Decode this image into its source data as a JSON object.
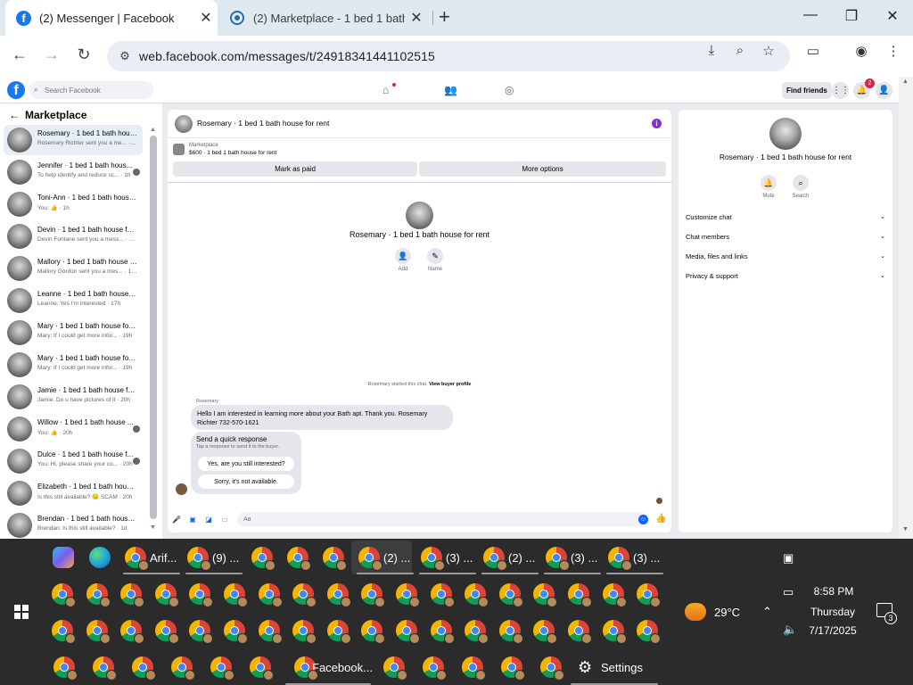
{
  "browser": {
    "tabs": [
      {
        "title": "(2) Messenger | Facebook",
        "active": true
      },
      {
        "title": "(2) Marketplace - 1 bed 1 bath h",
        "active": false
      }
    ],
    "url": "web.facebook.com/messages/t/24918341441102515",
    "window_controls": {
      "minimize": "—",
      "maximize": "❐",
      "close": "✕"
    }
  },
  "fb_header": {
    "search_placeholder": "Search Facebook",
    "find_friends": "Find friends",
    "notif_count": "2"
  },
  "sidebar": {
    "title": "Marketplace",
    "chats": [
      {
        "name": "Rosemary · 1 bed 1 bath house...",
        "preview": "Rosemary Richter sent you a me... · 7m",
        "selected": true,
        "seen_icon": false
      },
      {
        "name": "Jennifer · 1 bed 1 bath hous...",
        "preview": "To help identify and reduce sc... · 1h",
        "selected": false,
        "seen_icon": true
      },
      {
        "name": "Toni-Ann · 1 bed 1 bath house ...",
        "preview": "You: 👍 · 1h",
        "selected": false,
        "seen_icon": false
      },
      {
        "name": "Devin · 1 bed 1 bath house for ...",
        "preview": "Devin Fontane sent you a mess... · 15h",
        "selected": false,
        "seen_icon": false
      },
      {
        "name": "Mallory · 1 bed 1 bath house f...",
        "preview": "Mallory Gordon sent you a mes... · 16h",
        "selected": false,
        "seen_icon": false
      },
      {
        "name": "Leanne · 1 bed 1 bath house fo...",
        "preview": "Leanne: Yes I'm interested · 17h",
        "selected": false,
        "seen_icon": false
      },
      {
        "name": "Mary · 1 bed 1 bath house for ...",
        "preview": "Mary: If I could get more infor... · 19h",
        "selected": false,
        "seen_icon": false
      },
      {
        "name": "Mary · 1 bed 1 bath house for ...",
        "preview": "Mary: If I could get more infor... · 19h",
        "selected": false,
        "seen_icon": false
      },
      {
        "name": "Jamie · 1 bed 1 bath house for ...",
        "preview": "Jamie: Do u have pictures of it · 20h",
        "selected": false,
        "seen_icon": false
      },
      {
        "name": "Willow · 1 bed 1 bath house ...",
        "preview": "You: 👍 · 20h",
        "selected": false,
        "seen_icon": true
      },
      {
        "name": "Dulce · 1 bed 1 bath house f...",
        "preview": "You: Hi, please share your co... · 20h",
        "selected": false,
        "seen_icon": true
      },
      {
        "name": "Elizabeth · 1 bed 1 bath house ...",
        "preview": "Is this still available? 😔 SCAM · 20h",
        "selected": false,
        "seen_icon": false
      },
      {
        "name": "Brendan · 1 bed 1 bath house f...",
        "preview": "Brendan: Is this still available? · 1d",
        "selected": false,
        "seen_icon": false
      }
    ]
  },
  "conversation": {
    "title": "Rosemary · 1 bed 1 bath house for rent",
    "marketplace_label": "Marketplace",
    "listing": "$600 · 1 bed 1 bath house for rent",
    "mark_as_paid": "Mark as paid",
    "more_options": "More options",
    "center_name": "Rosemary · 1 bed 1 bath house for rent",
    "add_label": "Add",
    "name_label": "Name",
    "started_text": "Rosemary started this chat.",
    "view_buyer": "View buyer profile",
    "sender": "Rosemary",
    "message": "Hello I am interested in learning more about your Bath apt. Thank you. Rosemary Richter 732-570-1621",
    "quick_title": "Send a quick response",
    "quick_sub": "Tap a response to send it to the buyer.",
    "quick_1": "Yes, are you still interested?",
    "quick_2": "Sorry, it's not available.",
    "composer_placeholder": "Aa"
  },
  "details": {
    "name": "Rosemary · 1 bed 1 bath house for rent",
    "mute": "Mute",
    "search": "Search",
    "rows": [
      "Customize chat",
      "Chat members",
      "Media, files and links",
      "Privacy & support"
    ]
  },
  "taskbar": {
    "labeled_apps": [
      {
        "label": "Arif..."
      },
      {
        "label": "(9) ..."
      },
      {
        "label": "(2) ..."
      },
      {
        "label": "(3) ..."
      },
      {
        "label": "(2) ..."
      },
      {
        "label": "(3) ..."
      },
      {
        "label": "(3) ..."
      }
    ],
    "facebook_label": "Facebook...",
    "settings_label": "Settings",
    "weather": "29°C",
    "time": "8:58 PM",
    "day": "Thursday",
    "date": "7/17/2025",
    "notification_count": "3"
  },
  "colors": {
    "fb_blue": "#1877f2",
    "messenger_blue": "#0866ff",
    "taskbar": "#2b2b2b",
    "notification_red": "#e41e3f"
  }
}
